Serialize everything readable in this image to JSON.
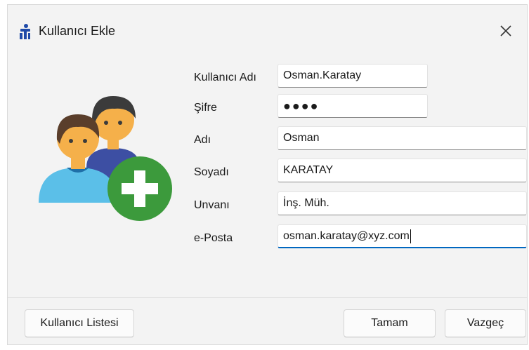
{
  "window": {
    "title": "Kullanıcı Ekle",
    "icon": "user-add-app-icon",
    "close_icon": "close-icon"
  },
  "illustration": {
    "icon": "users-add-icon",
    "colors": {
      "hair": "#3b3b3b",
      "skin": "#f5b04a",
      "shirt_front": "#5bbfe8",
      "shirt_back": "#3d4fa3",
      "plus_badge": "#3c9a3c"
    }
  },
  "form": {
    "fields": [
      {
        "label": "Kullanıcı Adı",
        "value": "Osman.Karatay"
      },
      {
        "label": "Şifre",
        "value": "●●●●"
      },
      {
        "label": "Adı",
        "value": "Osman"
      },
      {
        "label": "Soyadı",
        "value": "KARATAY"
      },
      {
        "label": "Unvanı",
        "value": "İnş. Müh."
      },
      {
        "label": "e-Posta",
        "value": "osman.karatay@xyz.com"
      }
    ]
  },
  "footer": {
    "user_list_button": "Kullanıcı Listesi",
    "ok_button": "Tamam",
    "cancel_button": "Vazgeç"
  },
  "colors": {
    "accent": "#0067c0",
    "dialog_bg": "#f3f3f3"
  }
}
